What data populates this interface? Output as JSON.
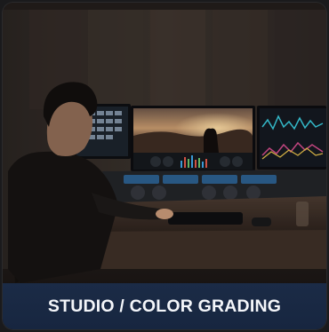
{
  "card": {
    "caption": "STUDIO / COLOR GRADING"
  },
  "image": {
    "subject": "color grading studio"
  },
  "colors": {
    "label_bar": "#1b2b46",
    "label_text": "#f4f6fa",
    "background": "#1a1a1c"
  }
}
